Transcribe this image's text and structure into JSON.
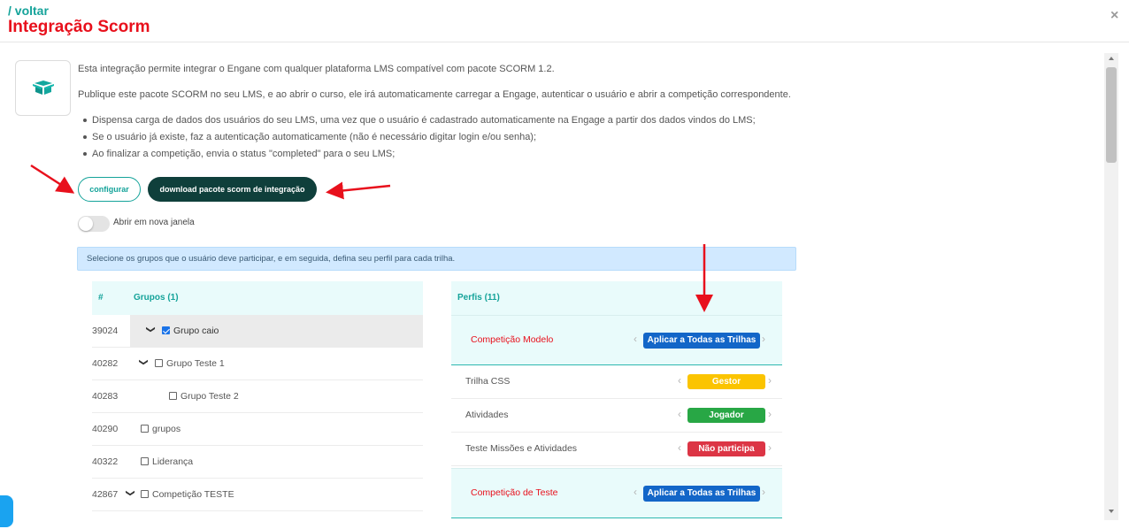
{
  "header": {
    "back_label": "/ voltar",
    "title": "Integração Scorm",
    "close_glyph": "×"
  },
  "intro": {
    "line1": "Esta integração permite integrar o Engane com qualquer plataforma LMS compatível com pacote SCORM 1.2.",
    "line2": "Publique este pacote SCORM no seu LMS, e ao abrir o curso, ele irá automaticamente carregar a Engage, autenticar o usuário e abrir a competição correspondente.",
    "bullets": [
      "Dispensa carga de dados dos usuários do seu LMS, uma vez que o usuário é cadastrado automaticamente na Engage a partir dos dados vindos do LMS;",
      "Se o usuário já existe, faz a autenticação automaticamente (não é necessário digitar login e/ou senha);",
      "Ao finalizar a competição, envia o status \"completed\" para o seu LMS;"
    ]
  },
  "actions": {
    "configure_label": "configurar",
    "download_label": "download pacote scorm de integração"
  },
  "toggle": {
    "label": "Abrir em nova janela",
    "on": false
  },
  "info_text": "Selecione os grupos que o usuário deve participar, e em seguida, defina seu perfil para cada trilha.",
  "groups": {
    "col_id": "#",
    "col_name": "Grupos (1)",
    "rows": [
      {
        "id": "39024",
        "name": "Grupo caio",
        "checked": true,
        "expand": "down",
        "level": 0,
        "selected": true
      },
      {
        "id": "40282",
        "name": "Grupo Teste 1",
        "checked": false,
        "expand": "down",
        "level": 0,
        "selected": false
      },
      {
        "id": "40283",
        "name": "Grupo Teste 2",
        "checked": false,
        "expand": "",
        "level": 1,
        "selected": false
      },
      {
        "id": "40290",
        "name": "grupos",
        "checked": false,
        "expand": "",
        "level": 0,
        "selected": false
      },
      {
        "id": "40322",
        "name": "Liderança",
        "checked": false,
        "expand": "",
        "level": 0,
        "selected": false
      },
      {
        "id": "42867",
        "name": "Competição TESTE",
        "checked": false,
        "expand": "down",
        "level": 0,
        "selected": false
      }
    ]
  },
  "profiles": {
    "header": "Perfis (11)",
    "competitions": [
      {
        "name": "Competição Modelo",
        "apply_label": "Aplicar a Todas as Trilhas"
      },
      {
        "name": "Competição de Teste",
        "apply_label": "Aplicar a Todas as Trilhas"
      }
    ],
    "trails": [
      {
        "name": "Trilha CSS",
        "role": "Gestor",
        "color": "#fbc400",
        "text_color": "#ffffff"
      },
      {
        "name": "Atividades",
        "role": "Jogador",
        "color": "#28a745",
        "text_color": "#ffffff"
      },
      {
        "name": "Teste Missões e Atividades",
        "role": "Não participa",
        "color": "#dc3545",
        "text_color": "#ffffff"
      }
    ]
  },
  "colors": {
    "accent": "#15a39a",
    "title_red": "#e8101c",
    "dark_button": "#0f3f3b",
    "apply_blue": "#1366c8",
    "annotation_arrow": "#e8101c"
  }
}
